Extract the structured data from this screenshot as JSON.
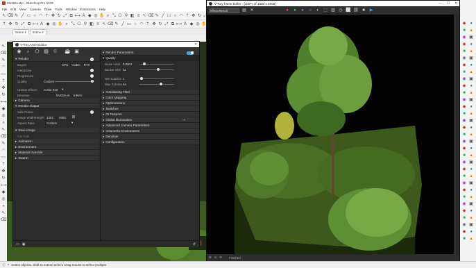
{
  "sketchup": {
    "title": "Mir48sv.skp - SketchUp Pro 2019",
    "menu": [
      "File",
      "Edit",
      "View",
      "Camera",
      "Draw",
      "Tools",
      "Window",
      "Extensions",
      "Help"
    ],
    "scenes": [
      "Scene 1",
      "Scene 2"
    ],
    "toolbar_icons": [
      "select-arrow",
      "eraser",
      "pencil",
      "line",
      "rectangle",
      "circle",
      "arc",
      "push-pull",
      "move",
      "rotate",
      "scale",
      "offset",
      "tape",
      "text",
      "paint",
      "orbit",
      "pan",
      "zoom",
      "zoom-extents",
      "camera",
      "walk",
      "section",
      "layer"
    ],
    "left_tools": [
      "arrow",
      "eraser",
      "pencil",
      "arc",
      "rect",
      "push",
      "move",
      "rotate",
      "tape",
      "paint",
      "orbit",
      "zoom"
    ]
  },
  "status_bar": {
    "text": "Select objects. Shift to extend select. Drag mouse to select multiple."
  },
  "asset_editor": {
    "title": "V-Ray Asset Editor",
    "toolbar_icons": [
      "materials-icon",
      "lights-icon",
      "geometry-icon",
      "textures-icon",
      "settings-icon",
      "render-icon",
      "frame-buffer-icon"
    ],
    "left": {
      "render_header": "Render",
      "engine_label": "Engine",
      "engine_options": [
        "CPU",
        "CUDA",
        "RTX"
      ],
      "interactive_label": "Interactive",
      "progressive_label": "Progressive",
      "quality_label": "Quality",
      "quality_value": "Custom",
      "update_effects_label": "Update Effects",
      "update_effects_value": "At the End",
      "denoiser_label": "Denoiser",
      "denoiser_options": [
        "NVIDIA AI",
        "V-RAY"
      ],
      "camera_header": "Camera",
      "render_output_header": "Render Output",
      "safe_frame_label": "Safe Frame",
      "image_wh_label": "Image Width/Height",
      "image_width": "1303",
      "image_height": "2000",
      "aspect_ratio_label": "Aspect Ratio",
      "aspect_ratio_value": "Custom",
      "save_image_header": "Save Image",
      "file_path_placeholder": "File Path",
      "animation_header": "Animation",
      "environment_header": "Environment",
      "material_override_header": "Material Override",
      "swarm_header": "Swarm"
    },
    "right": {
      "render_parameters_header": "Render Parameters",
      "quality_header": "Quality",
      "noise_limit_label": "Noise Limit",
      "noise_limit_value": "0.0001",
      "noise_limit_fraction": 0.1,
      "bucket_size_label": "Bucket Size",
      "bucket_size_value": "32",
      "bucket_size_fraction": 0.55,
      "min_subdivs_label": "Min Subdivs",
      "min_subdivs_value": "1",
      "min_subdivs_fraction": 0.02,
      "max_subdivs_label": "Max Subdivs",
      "max_subdivs_value": "64",
      "max_subdivs_fraction": 0.62,
      "antialiasing_header": "Antialiasing Filter",
      "color_mapping_header": "Color Mapping",
      "optimizations_header": "Optimizations",
      "switches_header": "Switches",
      "gi_textures_header": "GI Textures",
      "global_illumination_header": "Global Illumination",
      "advanced_camera_header": "Advanced Camera Parameters",
      "volumetric_header": "Volumetric Environment",
      "denoiser_header": "Denoiser",
      "configuration_header": "Configuration"
    }
  },
  "vfb": {
    "title": "V-Ray frame buffer - [100% of 1303 x 2000]",
    "channel": "effectsResult",
    "status": "Finished"
  },
  "colors": {
    "accent_blue": "#4fa3d6",
    "panel_dark": "#2b2b2b",
    "render_bg": "#030303"
  }
}
